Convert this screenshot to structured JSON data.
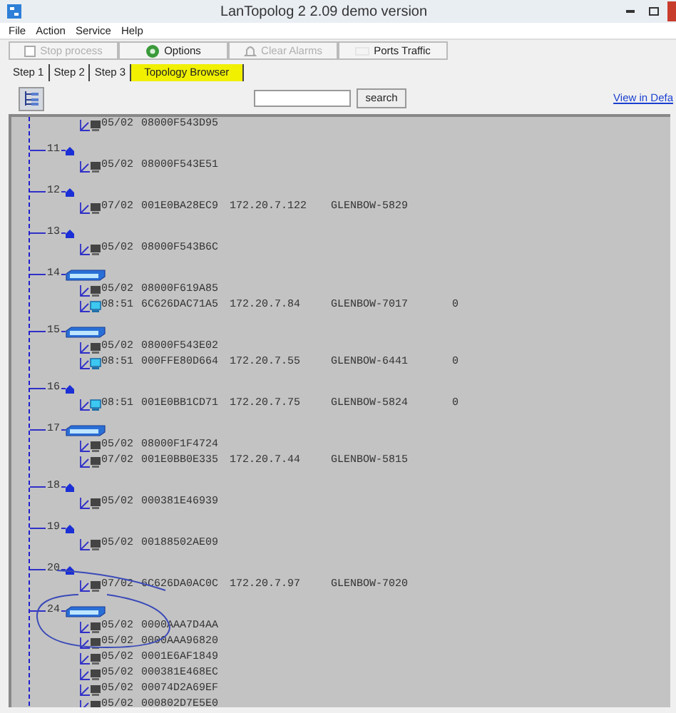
{
  "window": {
    "title": "LanTopolog 2 2.09 demo version"
  },
  "menu": [
    "File",
    "Action",
    "Service",
    "Help"
  ],
  "toolbar": [
    {
      "label": "Stop process",
      "kind": "stop",
      "disabled": true
    },
    {
      "label": "Options",
      "kind": "gear",
      "disabled": false
    },
    {
      "label": "Clear Alarms",
      "kind": "bell",
      "disabled": true
    },
    {
      "label": "Ports Traffic",
      "kind": "traffic",
      "disabled": false
    }
  ],
  "tabs": [
    {
      "label": "Step 1",
      "selected": false
    },
    {
      "label": "Step 2",
      "selected": false
    },
    {
      "label": "Step 3",
      "selected": false
    },
    {
      "label": "Topology Browser",
      "selected": true
    }
  ],
  "search": {
    "button": "search"
  },
  "view_link": "View in Defa",
  "tree": {
    "top_entries": [
      {
        "kind": "pc",
        "time": "05/02",
        "mac": "08000F543D95"
      }
    ],
    "ports": [
      {
        "port": "11",
        "kind": "node",
        "children": [
          {
            "kind": "pc",
            "time": "05/02",
            "mac": "08000F543E51"
          }
        ]
      },
      {
        "port": "12",
        "kind": "node",
        "children": [
          {
            "kind": "pc",
            "time": "07/02",
            "mac": "001E0BA28EC9",
            "ip": "172.20.7.122",
            "host": "GLENBOW-5829"
          }
        ]
      },
      {
        "port": "13",
        "kind": "node",
        "children": [
          {
            "kind": "pc",
            "time": "05/02",
            "mac": "08000F543B6C"
          }
        ]
      },
      {
        "port": "14",
        "kind": "switch",
        "children": [
          {
            "kind": "pc",
            "time": "05/02",
            "mac": "08000F619A85"
          },
          {
            "kind": "workstation",
            "time": "08:51",
            "mac": "6C626DAC71A5",
            "ip": "172.20.7.84",
            "host": "GLENBOW-7017",
            "count": "0"
          }
        ]
      },
      {
        "port": "15",
        "kind": "switch",
        "children": [
          {
            "kind": "pc",
            "time": "05/02",
            "mac": "08000F543E02"
          },
          {
            "kind": "workstation",
            "time": "08:51",
            "mac": "000FFE80D664",
            "ip": "172.20.7.55",
            "host": "GLENBOW-6441",
            "count": "0"
          }
        ]
      },
      {
        "port": "16",
        "kind": "node",
        "children": [
          {
            "kind": "workstation",
            "time": "08:51",
            "mac": "001E0BB1CD71",
            "ip": "172.20.7.75",
            "host": "GLENBOW-5824",
            "count": "0"
          }
        ]
      },
      {
        "port": "17",
        "kind": "switch",
        "children": [
          {
            "kind": "pc",
            "time": "05/02",
            "mac": "08000F1F4724"
          },
          {
            "kind": "pc",
            "time": "07/02",
            "mac": "001E0BB0E335",
            "ip": "172.20.7.44",
            "host": "GLENBOW-5815"
          }
        ]
      },
      {
        "port": "18",
        "kind": "node",
        "children": [
          {
            "kind": "pc",
            "time": "05/02",
            "mac": "000381E46939"
          }
        ]
      },
      {
        "port": "19",
        "kind": "node",
        "children": [
          {
            "kind": "pc",
            "time": "05/02",
            "mac": "00188502AE09"
          }
        ]
      },
      {
        "port": "20",
        "kind": "node",
        "children": [
          {
            "kind": "pc",
            "time": "07/02",
            "mac": "6C626DA0AC0C",
            "ip": "172.20.7.97",
            "host": "GLENBOW-7020"
          }
        ]
      },
      {
        "port": "24",
        "kind": "switch",
        "children": [
          {
            "kind": "pc",
            "time": "05/02",
            "mac": "0000AAA7D4AA"
          },
          {
            "kind": "pc",
            "time": "05/02",
            "mac": "0000AAA96820"
          },
          {
            "kind": "pc",
            "time": "05/02",
            "mac": "0001E6AF1849"
          },
          {
            "kind": "pc",
            "time": "05/02",
            "mac": "000381E468EC"
          },
          {
            "kind": "pc",
            "time": "05/02",
            "mac": "00074D2A69EF"
          },
          {
            "kind": "pc",
            "time": "05/02",
            "mac": "000802D7E5E0"
          }
        ]
      }
    ]
  }
}
